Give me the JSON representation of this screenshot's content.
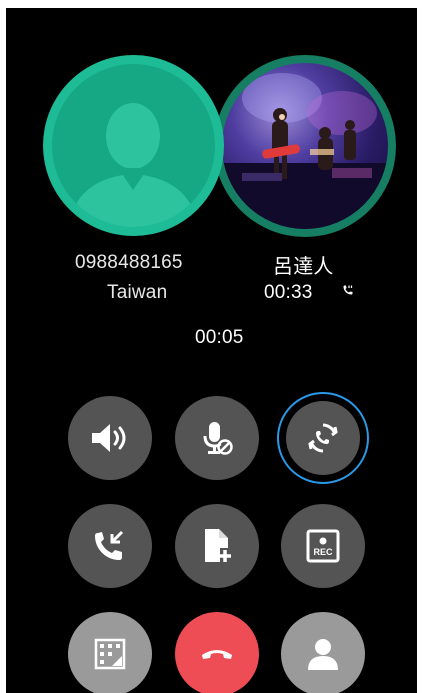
{
  "call": {
    "active_number": "0988488165",
    "active_location": "Taiwan",
    "held_contact_name": "呂達人",
    "held_duration": "00:33",
    "active_duration": "00:05"
  },
  "icons": {
    "held_status": "on-hold-phone-icon"
  },
  "colors": {
    "avatar_ring_active": "#1ebc96",
    "avatar_ring_held": "#167e62",
    "button_bg": "#545454",
    "button_selected_ring": "#2a9ae8",
    "end_call": "#ef4d55"
  },
  "buttons": [
    {
      "name": "speaker-button",
      "icon": "speaker-icon"
    },
    {
      "name": "mute-button",
      "icon": "mic-off-icon"
    },
    {
      "name": "swap-calls-button",
      "icon": "swap-call-icon",
      "selected": true
    },
    {
      "name": "merge-calls-button",
      "icon": "merge-call-icon"
    },
    {
      "name": "add-note-button",
      "icon": "add-file-icon"
    },
    {
      "name": "record-button",
      "icon": "rec-icon",
      "label": "REC"
    },
    {
      "name": "keypad-button",
      "icon": "dialpad-icon"
    },
    {
      "name": "end-call-button",
      "icon": "hang-up-icon"
    },
    {
      "name": "contacts-button",
      "icon": "person-icon"
    }
  ]
}
